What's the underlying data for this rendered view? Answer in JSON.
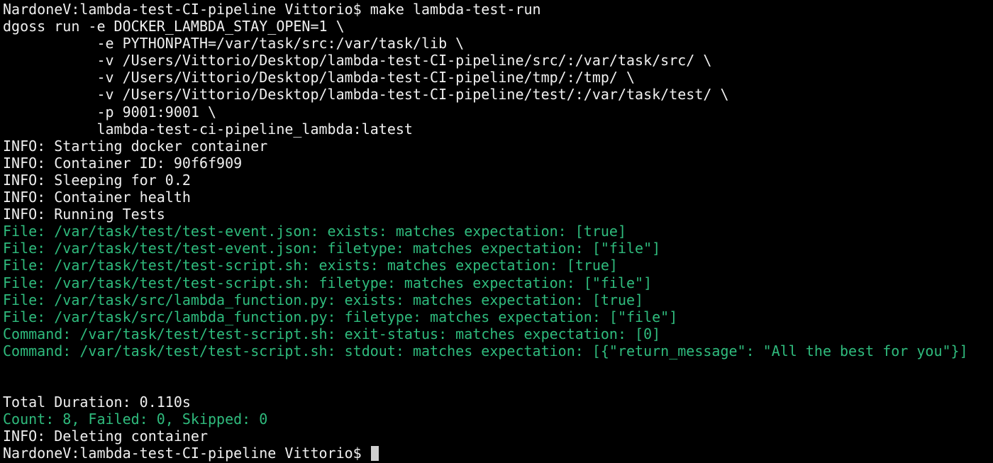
{
  "colors": {
    "background": "#000000",
    "default_text": "#f0f0f0",
    "success_text": "#2fbb7d",
    "cursor": "#cfcfcf"
  },
  "terminal": {
    "lines": [
      {
        "text": "NardoneV:lambda-test-CI-pipeline Vittorio$ make lambda-test-run",
        "style": "white"
      },
      {
        "text": "dgoss run -e DOCKER_LAMBDA_STAY_OPEN=1 \\",
        "style": "white"
      },
      {
        "text": "           -e PYTHONPATH=/var/task/src:/var/task/lib \\",
        "style": "white"
      },
      {
        "text": "           -v /Users/Vittorio/Desktop/lambda-test-CI-pipeline/src/:/var/task/src/ \\",
        "style": "white"
      },
      {
        "text": "           -v /Users/Vittorio/Desktop/lambda-test-CI-pipeline/tmp/:/tmp/ \\",
        "style": "white"
      },
      {
        "text": "           -v /Users/Vittorio/Desktop/lambda-test-CI-pipeline/test/:/var/task/test/ \\",
        "style": "white"
      },
      {
        "text": "           -p 9001:9001 \\",
        "style": "white"
      },
      {
        "text": "           lambda-test-ci-pipeline_lambda:latest",
        "style": "white"
      },
      {
        "text": "INFO: Starting docker container",
        "style": "white"
      },
      {
        "text": "INFO: Container ID: 90f6f909",
        "style": "white"
      },
      {
        "text": "INFO: Sleeping for 0.2",
        "style": "white"
      },
      {
        "text": "INFO: Container health",
        "style": "white"
      },
      {
        "text": "INFO: Running Tests",
        "style": "white"
      },
      {
        "text": "File: /var/task/test/test-event.json: exists: matches expectation: [true]",
        "style": "green"
      },
      {
        "text": "File: /var/task/test/test-event.json: filetype: matches expectation: [\"file\"]",
        "style": "green"
      },
      {
        "text": "File: /var/task/test/test-script.sh: exists: matches expectation: [true]",
        "style": "green"
      },
      {
        "text": "File: /var/task/test/test-script.sh: filetype: matches expectation: [\"file\"]",
        "style": "green"
      },
      {
        "text": "File: /var/task/src/lambda_function.py: exists: matches expectation: [true]",
        "style": "green"
      },
      {
        "text": "File: /var/task/src/lambda_function.py: filetype: matches expectation: [\"file\"]",
        "style": "green"
      },
      {
        "text": "Command: /var/task/test/test-script.sh: exit-status: matches expectation: [0]",
        "style": "green"
      },
      {
        "text": "Command: /var/task/test/test-script.sh: stdout: matches expectation: [{\"return_message\": \"All the best for you\"}]",
        "style": "green"
      },
      {
        "text": "",
        "style": "white"
      },
      {
        "text": "",
        "style": "white"
      },
      {
        "text": "Total Duration: 0.110s",
        "style": "white"
      },
      {
        "text": "Count: 8, Failed: 0, Skipped: 0",
        "style": "green"
      },
      {
        "text": "INFO: Deleting container",
        "style": "white"
      }
    ],
    "prompt": "NardoneV:lambda-test-CI-pipeline Vittorio$ "
  }
}
